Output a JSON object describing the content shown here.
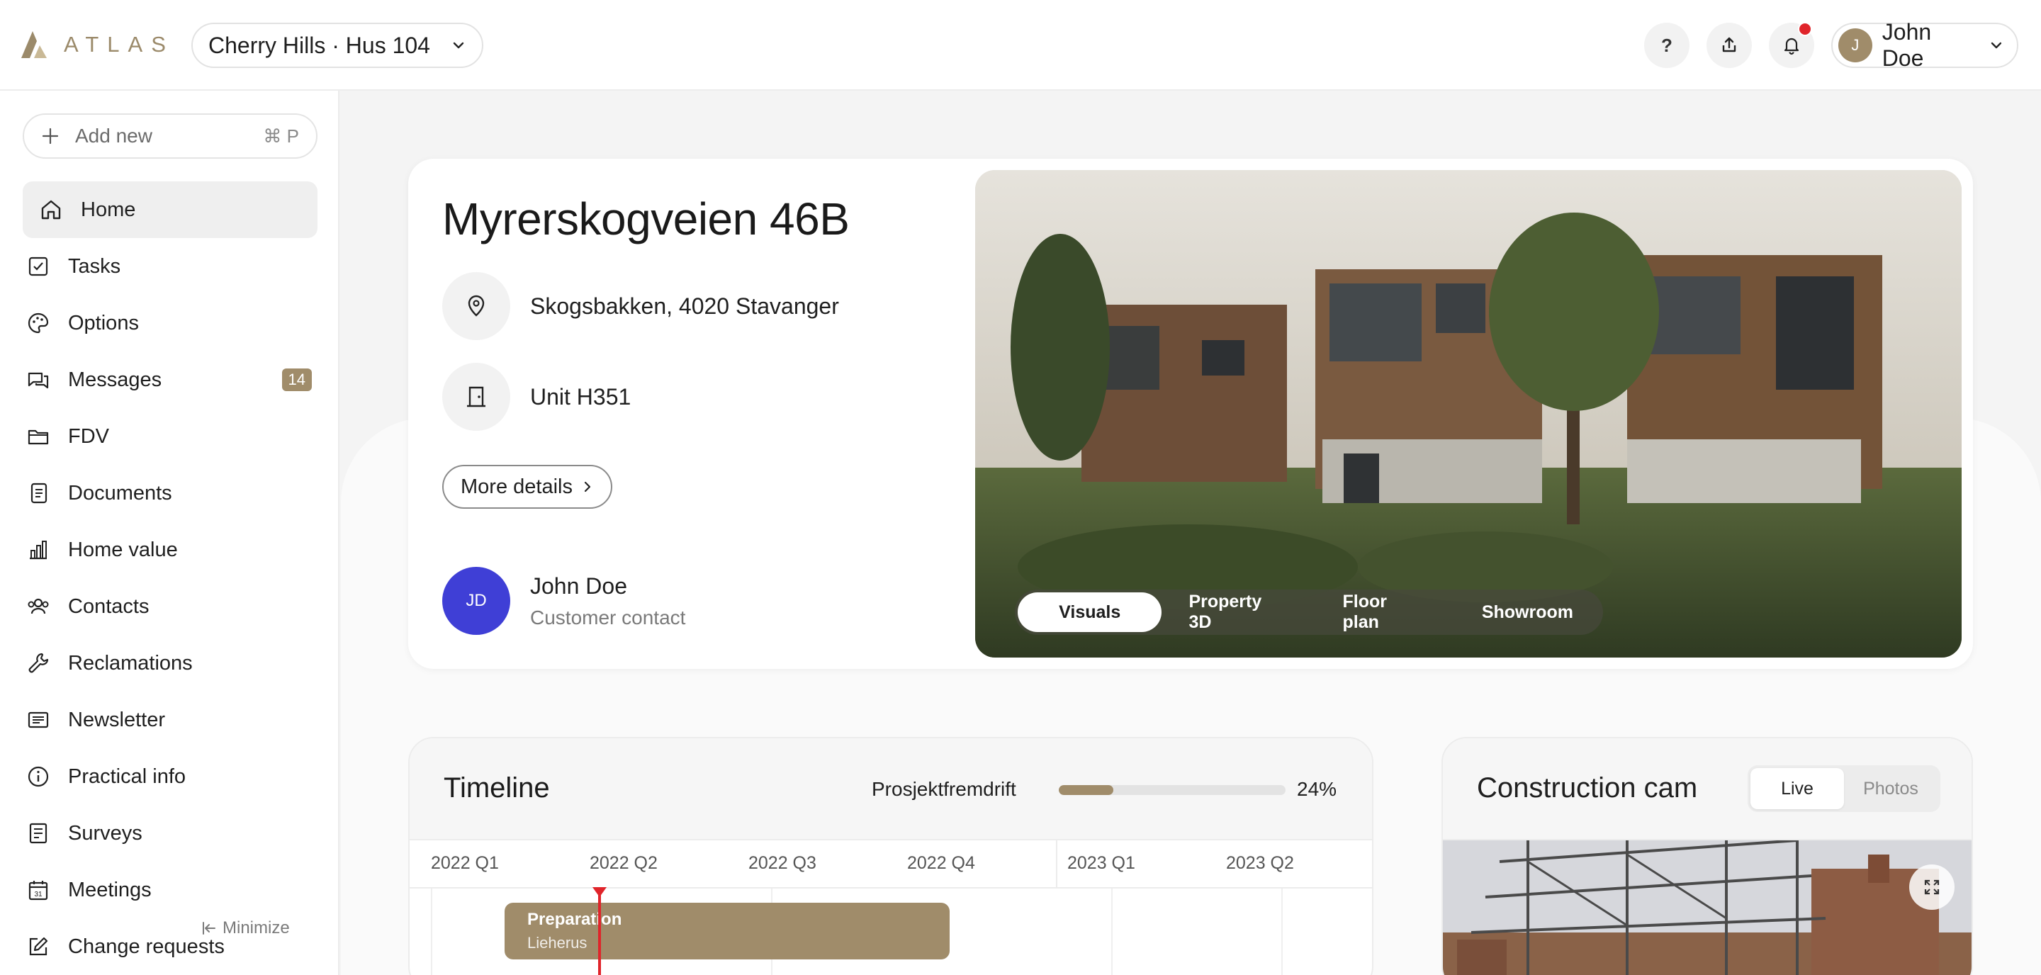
{
  "header": {
    "logo_text": "ATLAS",
    "project": "Cherry Hills · Hus 104",
    "help_label": "?",
    "user": {
      "initial": "J",
      "name": "John Doe"
    },
    "has_notification": true
  },
  "sidebar": {
    "add_new": {
      "label": "Add new",
      "shortcut": "⌘ P"
    },
    "items": [
      {
        "label": "Home",
        "icon": "home-icon",
        "active": true
      },
      {
        "label": "Tasks",
        "icon": "tasks-icon"
      },
      {
        "label": "Options",
        "icon": "palette-icon"
      },
      {
        "label": "Messages",
        "icon": "messages-icon",
        "badge": "14"
      },
      {
        "label": "FDV",
        "icon": "folder-icon"
      },
      {
        "label": "Documents",
        "icon": "documents-icon"
      },
      {
        "label": "Home value",
        "icon": "bar-chart-icon"
      },
      {
        "label": "Contacts",
        "icon": "contacts-icon"
      },
      {
        "label": "Reclamations",
        "icon": "wrench-icon"
      },
      {
        "label": "Newsletter",
        "icon": "newsletter-icon"
      },
      {
        "label": "Practical info",
        "icon": "info-icon"
      },
      {
        "label": "Surveys",
        "icon": "survey-icon"
      },
      {
        "label": "Meetings",
        "icon": "calendar-icon",
        "calendar_day": "31"
      },
      {
        "label": "Change requests",
        "icon": "edit-icon"
      }
    ],
    "minimize_label": "Minimize"
  },
  "property": {
    "title": "Myrerskogveien 46B",
    "address": "Skogsbakken, 4020 Stavanger",
    "unit": "Unit H351",
    "more_details": "More details",
    "contact": {
      "initials": "JD",
      "name": "John Doe",
      "role": "Customer contact"
    },
    "media_tabs": [
      "Visuals",
      "Property 3D",
      "Floor plan",
      "Showroom"
    ],
    "active_media_tab": "Visuals"
  },
  "timeline": {
    "title": "Timeline",
    "progress_label": "Prosjektfremdrift",
    "progress_pct": 24,
    "progress_text": "24%",
    "quarters": [
      "2022 Q1",
      "2022 Q2",
      "2022 Q3",
      "2022 Q4",
      "2023 Q1",
      "2023 Q2"
    ],
    "bars": [
      {
        "title": "Preparation",
        "subtitle": "Lieherus"
      }
    ]
  },
  "cam": {
    "title": "Construction cam",
    "options": [
      "Live",
      "Photos"
    ],
    "active_option": "Live"
  },
  "colors": {
    "accent": "#a08c6a",
    "contact_avatar": "#3f3fd6",
    "alert": "#e0242a"
  }
}
